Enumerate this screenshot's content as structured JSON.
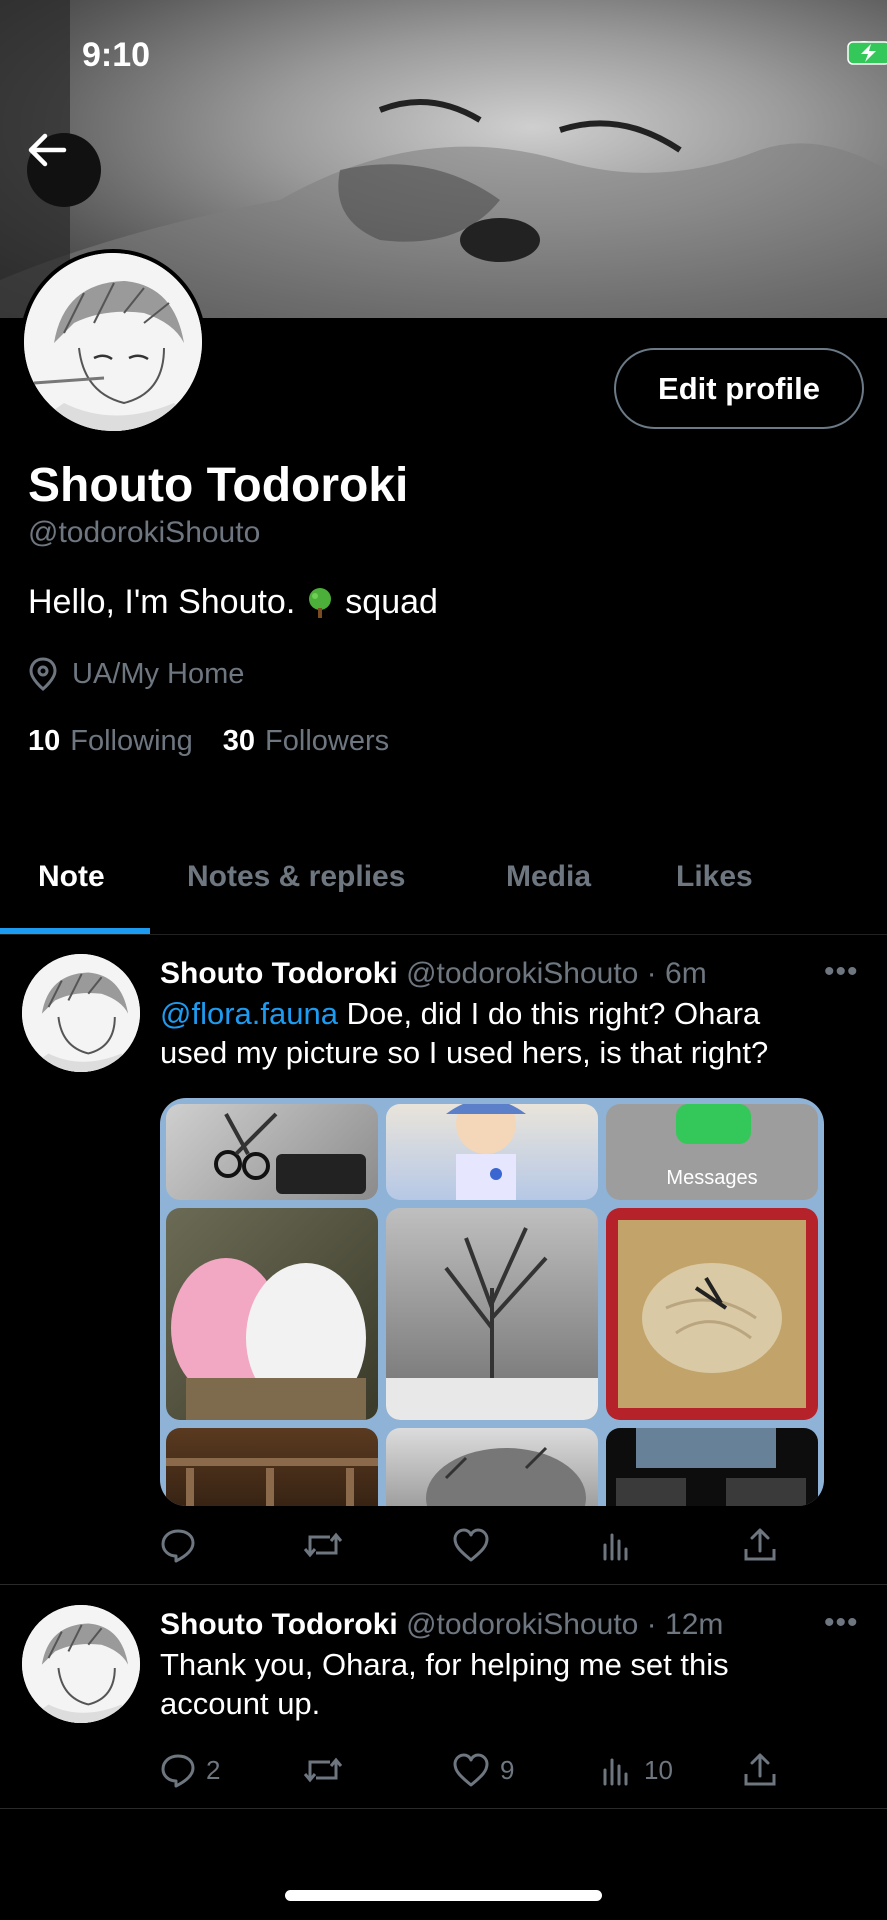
{
  "status_bar": {
    "time": "9:10"
  },
  "profile": {
    "name": "Shouto Todoroki",
    "handle": "@todorokiShouto",
    "bio_before": "Hello, I'm Shouto.",
    "bio_after": "squad",
    "location": "UA/My Home",
    "following_count": "10",
    "following_label": "Following",
    "followers_count": "30",
    "followers_label": "Followers",
    "edit_button": "Edit profile"
  },
  "tabs": [
    {
      "label": "Note",
      "active": true
    },
    {
      "label": "Notes & replies",
      "active": false
    },
    {
      "label": "Media",
      "active": false
    },
    {
      "label": "Likes",
      "active": false
    }
  ],
  "notes": [
    {
      "author": "Shouto Todoroki",
      "meta": "@todorokiShouto · 6m",
      "mention": "@flora.fauna",
      "text_line1": " Doe, did I do this right? Ohara",
      "text_line2": "used my picture so I used hers, is that right?",
      "media_label": "Messages",
      "replies": "",
      "renotes": "",
      "likes": "",
      "views": ""
    },
    {
      "author": "Shouto Todoroki",
      "meta": "@todorokiShouto · 12m",
      "text_line1": "Thank you, Ohara, for helping me set this",
      "text_line2": "account up.",
      "replies": "2",
      "renotes": "",
      "likes": "9",
      "views": "10"
    }
  ],
  "colors": {
    "accent": "#1d9bf0",
    "muted": "#6e7680",
    "background": "#000000"
  }
}
